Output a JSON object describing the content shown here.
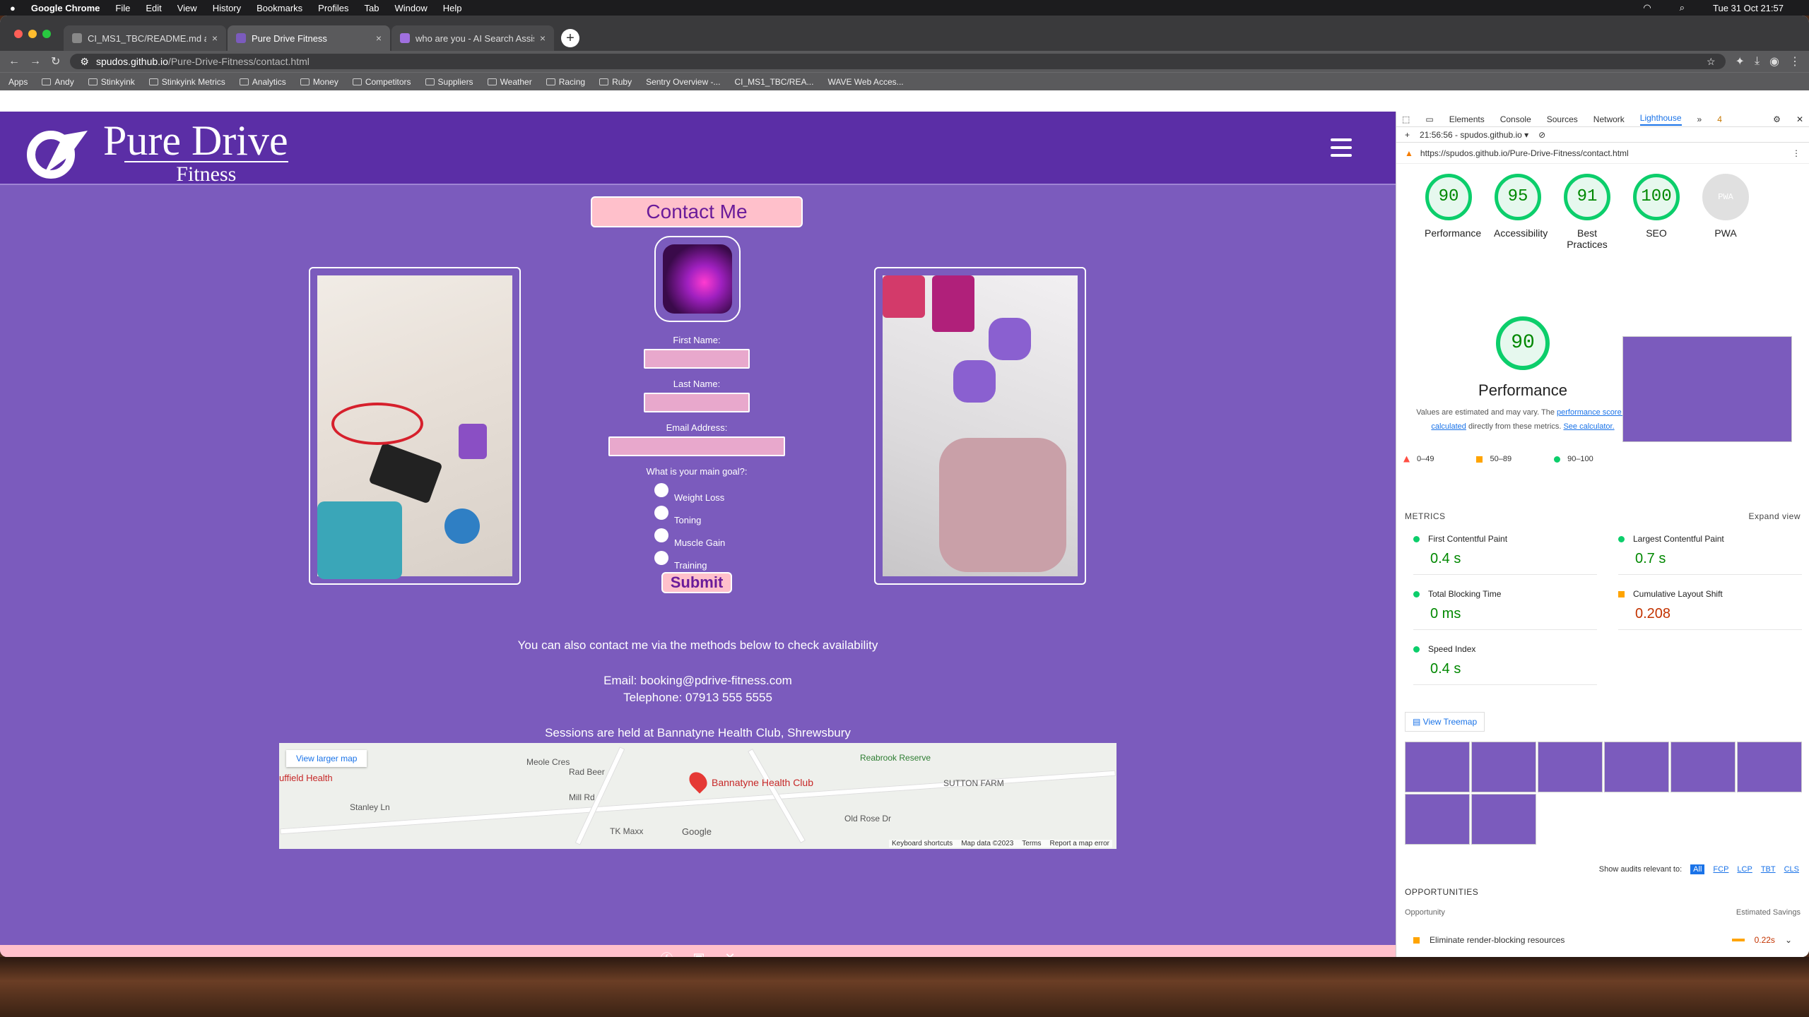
{
  "menubar": {
    "app": "Google Chrome",
    "items": [
      "File",
      "Edit",
      "View",
      "History",
      "Bookmarks",
      "Profiles",
      "Tab",
      "Window",
      "Help"
    ],
    "clock": "Tue 31 Oct  21:57"
  },
  "tabs": [
    {
      "label": "CI_MS1_TBC/README.md at m"
    },
    {
      "label": "Pure Drive Fitness"
    },
    {
      "label": "who are you - AI Search Assis"
    }
  ],
  "address": {
    "host": "spudos.github.io",
    "path": "/Pure-Drive-Fitness/contact.html"
  },
  "bookmarks": [
    "Apps",
    "Andy",
    "Stinkyink",
    "Stinkyink Metrics",
    "Analytics",
    "Money",
    "Competitors",
    "Suppliers",
    "Weather",
    "Racing",
    "Ruby",
    "Sentry Overview -...",
    "CI_MS1_TBC/REA...",
    "WAVE Web Acces..."
  ],
  "site": {
    "brand": "Pure Drive",
    "brand_sub": "Fitness",
    "title": "Contact Me",
    "form": {
      "first_name": "First Name:",
      "last_name": "Last Name:",
      "email": "Email Address:",
      "goal_question": "What is your main goal?:",
      "goals": [
        "Weight Loss",
        "Toning",
        "Muscle Gain",
        "Training"
      ],
      "submit": "Submit"
    },
    "info": {
      "line1": "You can also contact me via the methods below to check availability",
      "email": "Email: booking@pdrive-fitness.com",
      "phone": "Telephone: 07913 555 5555",
      "sessions": "Sessions are held at Bannatyne Health Club, Shrewsbury"
    },
    "map": {
      "view_larger": "View larger map",
      "place": "Bannatyne Health Club",
      "labels": [
        "Rad Beer",
        "Reabrook Reserve",
        "SUTTON FARM",
        "TK Maxx",
        "Old Rose Dr",
        "Stanley Ln",
        "Mill Rd",
        "Meole Cres"
      ],
      "hospital": "uffield Health",
      "google": "Google",
      "footer": [
        "Keyboard shortcuts",
        "Map data ©2023",
        "Terms",
        "Report a map error"
      ]
    }
  },
  "devtools": {
    "tabs": [
      "Elements",
      "Console",
      "Sources",
      "Network",
      "Lighthouse"
    ],
    "issues": "4",
    "session": "21:56:56 - spudos.github.io ▾",
    "url": "https://spudos.github.io/Pure-Drive-Fitness/contact.html",
    "scores": [
      {
        "name": "Performance",
        "value": "90"
      },
      {
        "name": "Accessibility",
        "value": "95"
      },
      {
        "name": "Best Practices",
        "value": "91"
      },
      {
        "name": "SEO",
        "value": "100"
      },
      {
        "name": "PWA",
        "value": "PWA"
      }
    ],
    "performance": {
      "score": "90",
      "title": "Performance",
      "desc1": "Values are estimated and may vary. The",
      "link1": "performance score is calculated",
      "desc2": "directly from these metrics.",
      "link2": "See calculator."
    },
    "legend": [
      "0–49",
      "50–89",
      "90–100"
    ],
    "metrics_title": "METRICS",
    "expand": "Expand view",
    "metrics": [
      {
        "name": "First Contentful Paint",
        "value": "0.4 s"
      },
      {
        "name": "Largest Contentful Paint",
        "value": "0.7 s"
      },
      {
        "name": "Total Blocking Time",
        "value": "0 ms"
      },
      {
        "name": "Cumulative Layout Shift",
        "value": "0.208"
      },
      {
        "name": "Speed Index",
        "value": "0.4 s"
      }
    ],
    "treemap": "View Treemap",
    "show_audits": "Show audits relevant to:",
    "filters": [
      "All",
      "FCP",
      "LCP",
      "TBT",
      "CLS"
    ],
    "opportunities": "OPPORTUNITIES",
    "opp_col1": "Opportunity",
    "opp_col2": "Estimated Savings",
    "opp_item": "Eliminate render-blocking resources",
    "opp_saving": "0.22s"
  }
}
